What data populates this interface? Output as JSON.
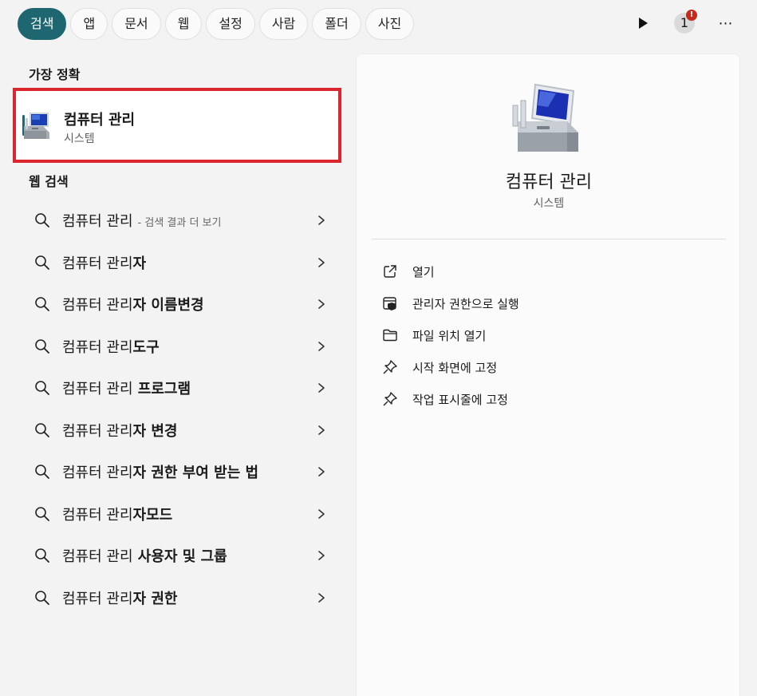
{
  "filters": [
    "검색",
    "앱",
    "문서",
    "웹",
    "설정",
    "사람",
    "폴더",
    "사진"
  ],
  "toolbar": {
    "play_icon": "play-icon",
    "badge_number": "1",
    "badge_alert": "!",
    "more": "⋯"
  },
  "best_match": {
    "heading": "가장 정확",
    "title": "컴퓨터 관리",
    "subtitle": "시스템",
    "icon": "computer-management-icon"
  },
  "web_search": {
    "heading": "웹 검색",
    "items": [
      {
        "prefix": "컴퓨터 관리",
        "bold": "",
        "suffix": "- 검색 결과 더 보기"
      },
      {
        "prefix": "컴퓨터 관리",
        "bold": "자",
        "suffix": ""
      },
      {
        "prefix": "컴퓨터 관리",
        "bold": "자 이름변경",
        "suffix": ""
      },
      {
        "prefix": "컴퓨터 관리",
        "bold": "도구",
        "suffix": ""
      },
      {
        "prefix": "컴퓨터 관리",
        "bold": " 프로그램",
        "suffix": ""
      },
      {
        "prefix": "컴퓨터 관리",
        "bold": "자 변경",
        "suffix": ""
      },
      {
        "prefix": "컴퓨터 관리",
        "bold": "자 권한 부여 받는 법",
        "suffix": ""
      },
      {
        "prefix": "컴퓨터 관리",
        "bold": "자모드",
        "suffix": ""
      },
      {
        "prefix": "컴퓨터 관리",
        "bold": " 사용자 및 그룹",
        "suffix": ""
      },
      {
        "prefix": "컴퓨터 관리",
        "bold": "자 권한",
        "suffix": ""
      }
    ]
  },
  "panel": {
    "title": "컴퓨터 관리",
    "subtitle": "시스템",
    "actions": [
      {
        "label": "열기",
        "icon": "open-external-icon"
      },
      {
        "label": "관리자 권한으로 실행",
        "icon": "admin-shield-icon"
      },
      {
        "label": "파일 위치 열기",
        "icon": "folder-icon"
      },
      {
        "label": "시작 화면에 고정",
        "icon": "pin-icon"
      },
      {
        "label": "작업 표시줄에 고정",
        "icon": "pin-icon"
      }
    ]
  }
}
